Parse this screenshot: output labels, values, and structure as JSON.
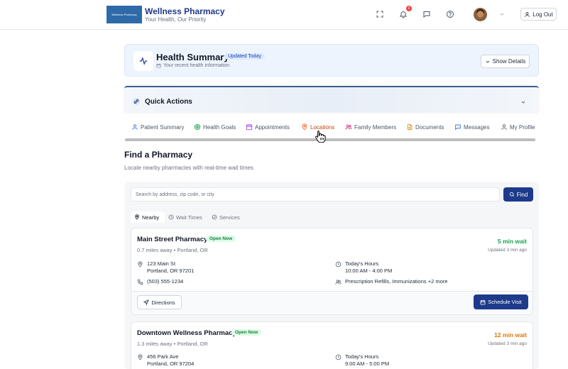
{
  "header": {
    "logo_text": "Wellness Pharmacy",
    "title": "Wellness Pharmacy",
    "subtitle": "Your Health, Our Priority",
    "notification_count": "2",
    "logout_label": "Log Out"
  },
  "health_summary": {
    "title": "Health Summary",
    "badge": "Updated Today",
    "subtitle": "Your recent health information",
    "show_details_label": "Show Details"
  },
  "quick_actions": {
    "title": "Quick Actions"
  },
  "tabs": [
    {
      "label": "Patient Summary",
      "icon": "user-icon"
    },
    {
      "label": "Health Goals",
      "icon": "target-icon"
    },
    {
      "label": "Appointments",
      "icon": "calendar-icon"
    },
    {
      "label": "Locations",
      "icon": "map-pin-icon",
      "active": true
    },
    {
      "label": "Family Members",
      "icon": "users-icon"
    },
    {
      "label": "Documents",
      "icon": "document-icon"
    },
    {
      "label": "Messages",
      "icon": "message-icon"
    },
    {
      "label": "My Profile",
      "icon": "user-icon"
    }
  ],
  "find": {
    "title": "Find a Pharmacy",
    "subtitle": "Locate nearby pharmacies with real-time wait times",
    "search_placeholder": "Search by address, zip code, or city",
    "find_label": "Find",
    "subtabs": [
      "Nearby",
      "Wait Times",
      "Services"
    ]
  },
  "pharmacies": [
    {
      "name": "Main Street Pharmacy",
      "status": "Open Now",
      "distance": "0.7 miles away • Portland, OR",
      "wait": "5 min wait",
      "wait_color": "#16a34a",
      "updated": "Updated 3 min ago",
      "address_line1": "123 Main St",
      "address_line2": "Portland, OR 97201",
      "phone": "(503) 555-1234",
      "hours_label": "Today's Hours",
      "hours": "10:00 AM - 4:00 PM",
      "services": "Prescription Refills, Immunizations +2 more",
      "directions_label": "Directions",
      "schedule_label": "Schedule Visit"
    },
    {
      "name": "Downtown Wellness Pharmacy",
      "status": "Open Now",
      "distance": "1.3 miles away • Portland, OR",
      "wait": "12 min wait",
      "wait_color": "#d97706",
      "updated": "Updated 3 min ago",
      "address_line1": "456 Park Ave",
      "address_line2": "Portland, OR 97204",
      "hours_label": "Today's Hours",
      "hours": "9:00 AM - 5:00 PM"
    }
  ],
  "colors": {
    "brand": "#1e3a8a",
    "active_tab": "#c2410c",
    "open_badge": "#15803d"
  }
}
